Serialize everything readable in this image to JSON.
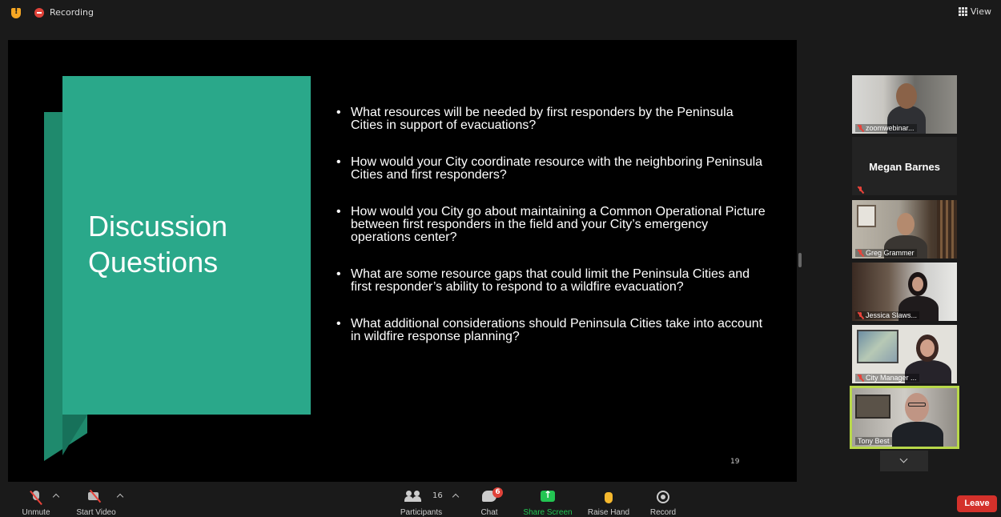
{
  "topbar": {
    "recording_label": "Recording",
    "view_label": "View"
  },
  "slide": {
    "title_line1": "Discussion",
    "title_line2": "Questions",
    "questions": [
      "What resources will be needed by first responders by the Peninsula Cities in support of evacuations?",
      "How would your City coordinate resource with the neighboring Peninsula Cities and first responders?",
      "How would you City go about maintaining a Common Operational Picture between first responders in the field and your City’s emergency operations center?",
      "What are some resource gaps that could limit the Peninsula Cities and first responder’s ability to respond to a wildfire evacuation?",
      "What additional considerations should Peninsula Cities take into account in wildfire response planning?"
    ],
    "page_number": "19",
    "accent_color": "#2aa88a"
  },
  "participants": [
    {
      "name": "zoomwebinar...",
      "muted": true
    },
    {
      "name": "Megan Barnes",
      "muted": true,
      "video_off": true
    },
    {
      "name": "Greg Grammer",
      "muted": true
    },
    {
      "name": "Jessica Slaws...",
      "muted": true
    },
    {
      "name": "City Manager ...",
      "muted": true
    },
    {
      "name": "Tony Best",
      "muted": false,
      "active_speaker": true
    }
  ],
  "toolbar": {
    "unmute_label": "Unmute",
    "start_video_label": "Start Video",
    "participants_label": "Participants",
    "participants_count": "16",
    "chat_label": "Chat",
    "chat_badge": "6",
    "share_label": "Share Screen",
    "raise_hand_label": "Raise Hand",
    "record_label": "Record",
    "leave_label": "Leave",
    "share_color": "#23c552",
    "leave_color": "#d4312b"
  }
}
